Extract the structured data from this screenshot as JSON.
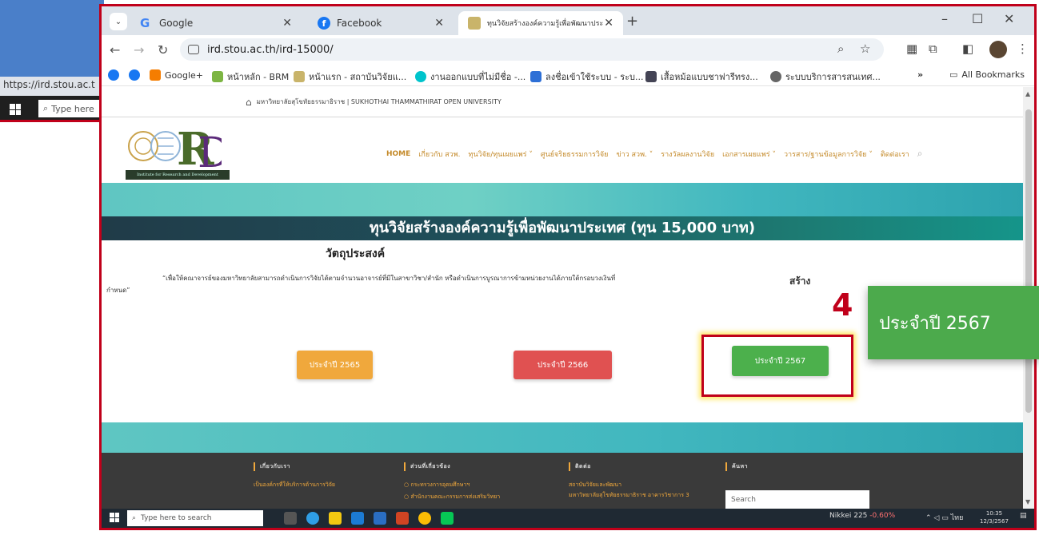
{
  "background": {
    "status_url": "https://ird.stou.ac.t",
    "search_placeholder": "Type here"
  },
  "browser": {
    "tabs": [
      {
        "title": "Google",
        "icon": "google-icon"
      },
      {
        "title": "Facebook",
        "icon": "facebook-icon"
      },
      {
        "title": "ทุนวิจัยสร้างองค์ความรู้เพื่อพัฒนาประ",
        "icon": "ird-favicon",
        "active": true
      }
    ],
    "url": "ird.stou.ac.th/ird-15000/",
    "bookmarks": [
      {
        "label": "",
        "icon": "facebook-icon"
      },
      {
        "label": "",
        "icon": "facebook-icon"
      },
      {
        "label": "Google+",
        "icon": "blogger-icon"
      },
      {
        "label": "หน้าหลัก - BRM",
        "icon": "brm-icon"
      },
      {
        "label": "หน้าแรก - สถาบันวิจัยแ...",
        "icon": "ird-icon"
      },
      {
        "label": "งานออกแบบที่ไม่มีชื่อ -...",
        "icon": "canva-icon"
      },
      {
        "label": "ลงชื่อเข้าใช้ระบบ - ระบ...",
        "icon": "login-icon"
      },
      {
        "label": "เสื้อหม้อแบบชาฟารีทรง...",
        "icon": "image-icon"
      },
      {
        "label": "ระบบบริการสารสนเทศ...",
        "icon": "globe-icon"
      }
    ],
    "all_bookmarks": "All Bookmarks"
  },
  "site": {
    "university": "มหาวิทยาลัยสุโขทัยธรรมาธิราช | SUKHOTHAI THAMMATHIRAT OPEN UNIVERSITY",
    "logo_caption": "Institute for Research and Development",
    "nav": [
      "HOME",
      "เกี่ยวกับ สวพ.",
      "ทุนวิจัย/ทุนเผยแพร่ ˅",
      "ศูนย์จริยธรรมการวิจัย",
      "ข่าว สวพ. ˅",
      "รางวัลผลงานวิจัย",
      "เอกสารเผยแพร่ ˅",
      "วารสาร/ฐานข้อมูลการวิจัย ˅",
      "ติดต่อเรา"
    ],
    "page_title": "ทุนวิจัยสร้างองค์ความรู้เพื่อพัฒนาประเทศ (ทุน 15,000 บาท)",
    "objective_title": "วัตถุประสงค์",
    "objective_text": "“เพื่อให้คณาจารย์ของมหาวิทยาลัยสามารถดำเนินการวิจัยได้ตามจำนวนอาจารย์ที่มีในสาขาวิชา/สำนัก หรือดำเนินการบูรณาการข้ามหน่วยงานได้ภายใต้กรอบวงเงินที่กำหนด”",
    "right_heading": "สร้าง",
    "buttons": [
      "ประจำปี 2565",
      "ประจำปี 2566",
      "ประจำปี 2567"
    ],
    "footer": {
      "cols": [
        {
          "head": "เกี่ยวกับเรา",
          "links": [
            "เป็นองค์กรที่ให้บริการด้านการวิจัย"
          ]
        },
        {
          "head": "ส่วนที่เกี่ยวข้อง",
          "links": [
            "○  กระทรวงการอุดมศึกษาฯ",
            "○  สำนักงานคณะกรรมการส่งเสริมวิทยา"
          ]
        },
        {
          "head": "ติดต่อ",
          "links": [
            "สถาบันวิจัยและพัฒนา",
            "มหาวิทยาลัยสุโขทัยธรรมาธิราช อาคารวิชาการ 3"
          ]
        },
        {
          "head": "ค้นหา",
          "links": []
        }
      ],
      "search_placeholder": "Search"
    }
  },
  "taskbar": {
    "search_placeholder": "Type here to search",
    "nikkei": "Nikkei 225",
    "nikkei_change": "-0.60%",
    "lang": "ไทย",
    "time": "10:35",
    "date": "12/3/2567"
  },
  "callout": {
    "step": "4",
    "label": "ประจำปี 2567"
  },
  "colors": {
    "highlight_red": "#c0001a",
    "btn_orange": "#f0a83c",
    "btn_red": "#e05151",
    "btn_green": "#4cb04c"
  }
}
